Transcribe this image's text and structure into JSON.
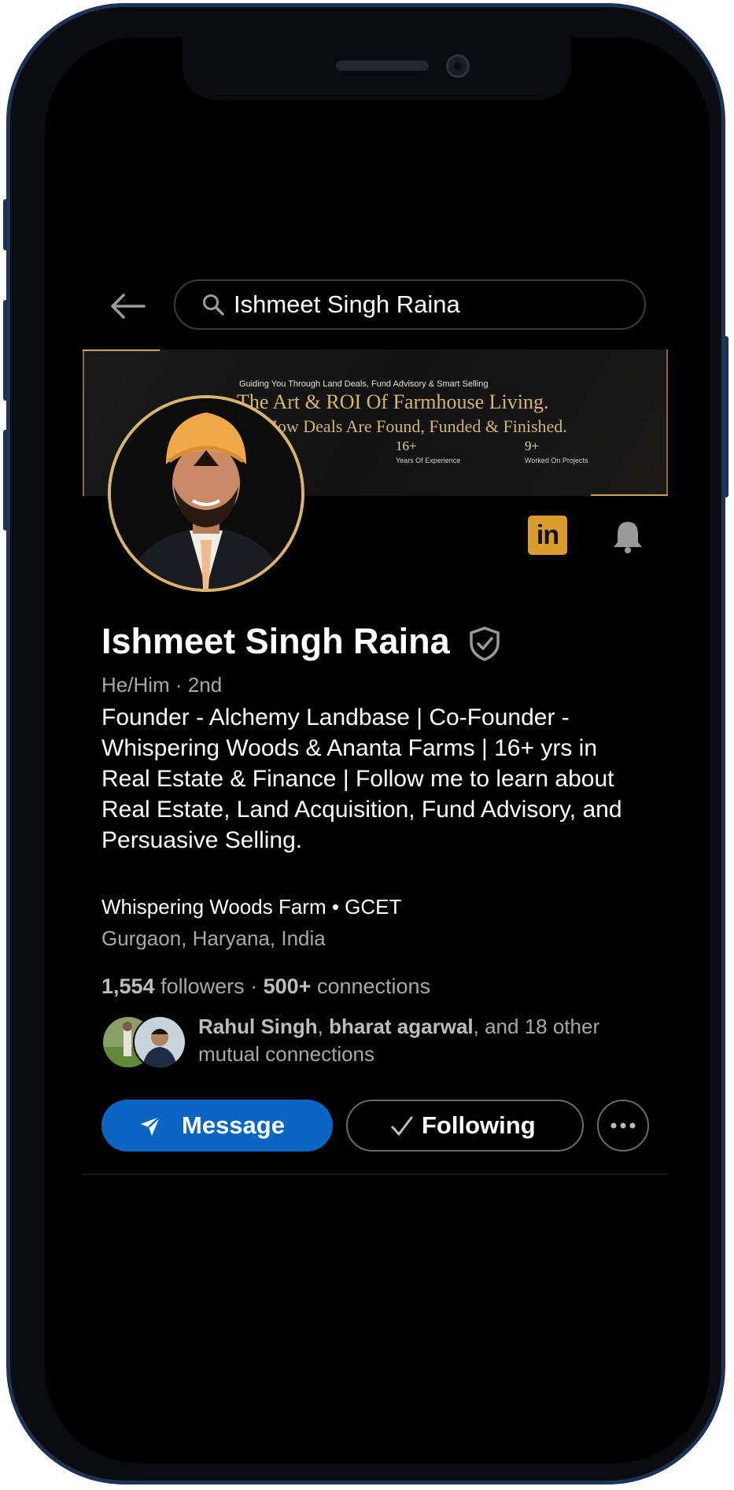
{
  "search": {
    "query": "Ishmeet Singh Raina"
  },
  "banner": {
    "tagline": "Guiding You Through Land Deals, Fund Advisory & Smart Selling",
    "title": "The Art & ROI Of Farmhouse Living.",
    "subtitle": "How Deals Are Found, Funded & Finished.",
    "stats": [
      {
        "value": "16+",
        "label": "Years Of Experience"
      },
      {
        "value": "9+",
        "label": "Worked On Projects"
      }
    ],
    "partial_text": "rd"
  },
  "profile": {
    "name": "Ishmeet Singh Raina",
    "pronouns_degree": "He/Him · 2nd",
    "headline": "Founder - Alchemy Landbase | Co-Founder - Whispering Woods & Ananta Farms | 16+ yrs in Real Estate & Finance | Follow me to learn about Real Estate, Land Acquisition, Fund Advisory, and Persuasive Selling.",
    "company": "Whispering Woods Farm • GCET",
    "location": "Gurgaon, Haryana, India",
    "followers_count": "1,554",
    "followers_label": " followers · ",
    "connections_count": "500+",
    "connections_label": " connections"
  },
  "mutual": {
    "name1": "Rahul Singh",
    "sep": ", ",
    "name2": "bharat agarwal",
    "rest": ", and 18 other mutual connections"
  },
  "actions": {
    "message": "Message",
    "following": "Following"
  },
  "colors": {
    "primary_button": "#0a66c2",
    "linkedin_badge": "#d99b2a",
    "banner_gold": "#d7b56b"
  },
  "icons": [
    "back-arrow-icon",
    "search-icon",
    "linkedin-icon",
    "bell-icon",
    "verified-shield-icon",
    "send-icon",
    "checkmark-icon",
    "more-icon"
  ]
}
